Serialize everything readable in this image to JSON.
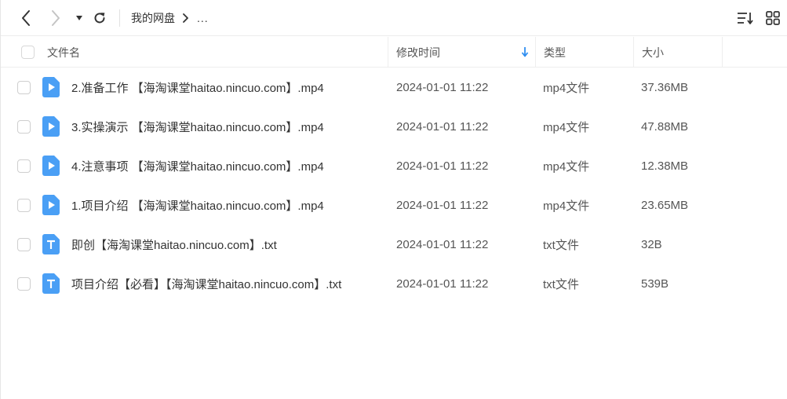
{
  "toolbar": {
    "breadcrumb_root": "我的网盘",
    "breadcrumb_more": "..."
  },
  "table": {
    "headers": {
      "name": "文件名",
      "time": "修改时间",
      "type": "类型",
      "size": "大小"
    },
    "sort": {
      "column": "time",
      "direction": "descending"
    },
    "rows": [
      {
        "name": "2.准备工作 【海淘课堂haitao.nincuo.com】.mp4",
        "time": "2024-01-01 11:22",
        "type": "mp4文件",
        "size": "37.36MB",
        "icon": "video-file-icon"
      },
      {
        "name": "3.实操演示 【海淘课堂haitao.nincuo.com】.mp4",
        "time": "2024-01-01 11:22",
        "type": "mp4文件",
        "size": "47.88MB",
        "icon": "video-file-icon"
      },
      {
        "name": "4.注意事项 【海淘课堂haitao.nincuo.com】.mp4",
        "time": "2024-01-01 11:22",
        "type": "mp4文件",
        "size": "12.38MB",
        "icon": "video-file-icon"
      },
      {
        "name": "1.项目介绍 【海淘课堂haitao.nincuo.com】.mp4",
        "time": "2024-01-01 11:22",
        "type": "mp4文件",
        "size": "23.65MB",
        "icon": "video-file-icon"
      },
      {
        "name": "即创【海淘课堂haitao.nincuo.com】.txt",
        "time": "2024-01-01 11:22",
        "type": "txt文件",
        "size": "32B",
        "icon": "text-file-icon"
      },
      {
        "name": "项目介绍【必看】【海淘课堂haitao.nincuo.com】.txt",
        "time": "2024-01-01 11:22",
        "type": "txt文件",
        "size": "539B",
        "icon": "text-file-icon"
      }
    ]
  },
  "colors": {
    "icon_blue": "#4a9ff5",
    "sort_arrow": "#2f8ef0",
    "toolbar_icon": "#333333",
    "disabled_icon": "#c4c4c4"
  }
}
